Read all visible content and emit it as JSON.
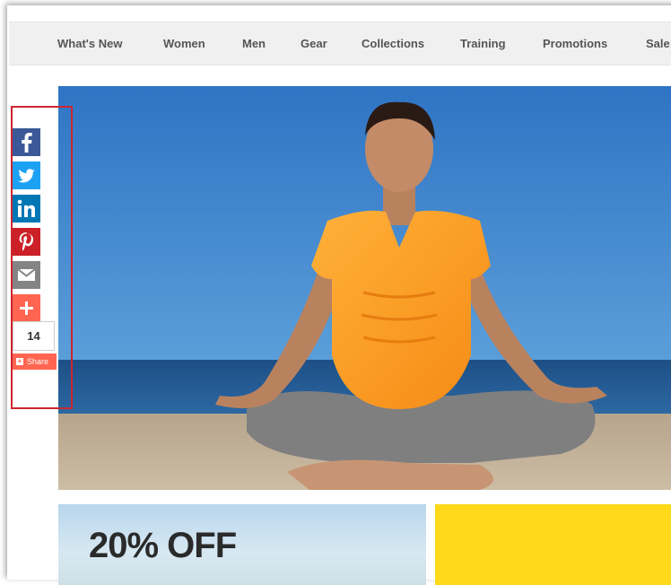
{
  "nav": {
    "items": [
      {
        "label": "What's New",
        "id": "whats-new"
      },
      {
        "label": "Women",
        "id": "women"
      },
      {
        "label": "Men",
        "id": "men"
      },
      {
        "label": "Gear",
        "id": "gear"
      },
      {
        "label": "Collections",
        "id": "collections"
      },
      {
        "label": "Training",
        "id": "training"
      },
      {
        "label": "Promotions",
        "id": "promotions"
      },
      {
        "label": "Sale",
        "id": "sale"
      }
    ]
  },
  "share": {
    "buttons": [
      {
        "network": "facebook",
        "icon": "facebook-icon",
        "color": "#3b5998"
      },
      {
        "network": "twitter",
        "icon": "twitter-icon",
        "color": "#1da1f2"
      },
      {
        "network": "linkedin",
        "icon": "linkedin-icon",
        "color": "#0077b5"
      },
      {
        "network": "pinterest",
        "icon": "pinterest-icon",
        "color": "#cb2027"
      },
      {
        "network": "email",
        "icon": "email-icon",
        "color": "#848484"
      },
      {
        "network": "more",
        "icon": "plus-icon",
        "color": "#ff6550"
      }
    ],
    "count": "14",
    "label": "Share"
  },
  "promo": {
    "left_headline": "20% OFF"
  },
  "colors": {
    "highlight_border": "#cc2630",
    "nav_bg": "#f0f0f0",
    "promo_yellow": "#ffd91a"
  }
}
